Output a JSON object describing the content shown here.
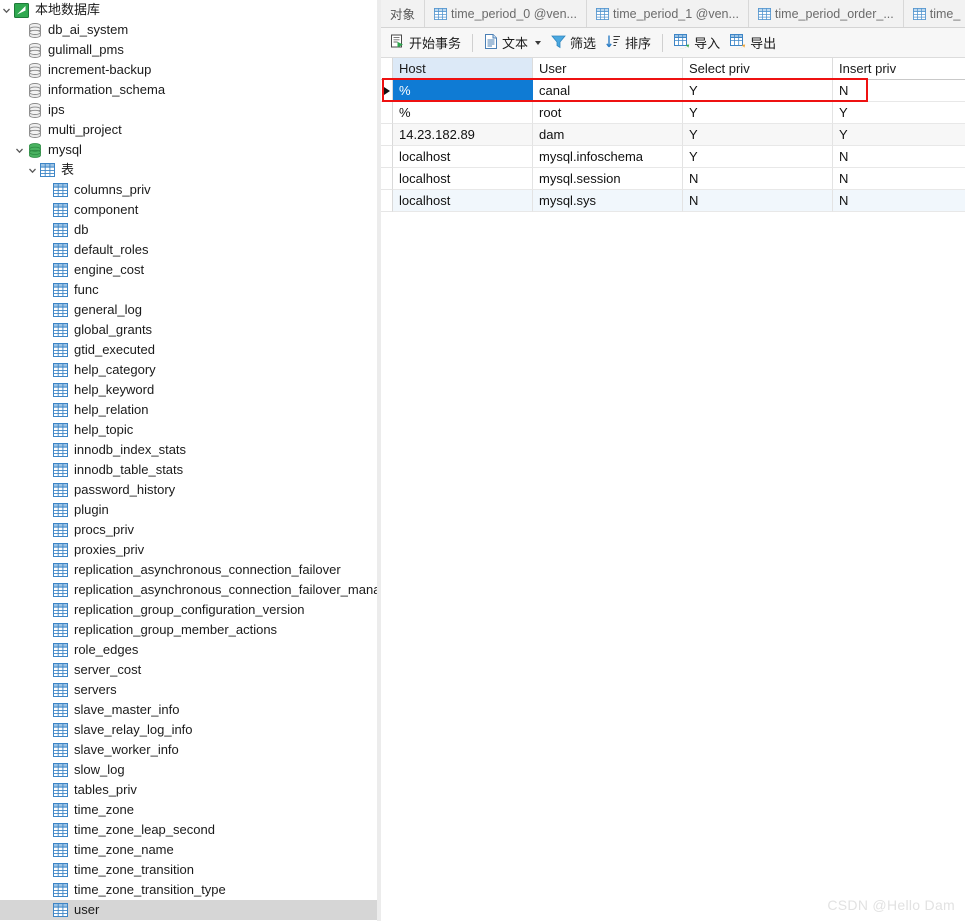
{
  "sidebar": {
    "root": {
      "label": "本地数据库",
      "icon": "navicat-connection-icon",
      "expanded": true
    },
    "databases": [
      {
        "label": "db_ai_system",
        "icon": "database-icon",
        "open": false
      },
      {
        "label": "gulimall_pms",
        "icon": "database-icon",
        "open": false
      },
      {
        "label": "increment-backup",
        "icon": "database-icon",
        "open": false
      },
      {
        "label": "information_schema",
        "icon": "database-icon",
        "open": false
      },
      {
        "label": "ips",
        "icon": "database-icon",
        "open": false
      },
      {
        "label": "multi_project",
        "icon": "database-icon",
        "open": false
      }
    ],
    "open_database": {
      "label": "mysql",
      "icon": "database-open-icon",
      "expanded": true
    },
    "tables_folder": {
      "label": "表",
      "icon": "table-folder-icon",
      "expanded": true
    },
    "tables": [
      {
        "label": "columns_priv",
        "selected": false
      },
      {
        "label": "component",
        "selected": false
      },
      {
        "label": "db",
        "selected": false
      },
      {
        "label": "default_roles",
        "selected": false
      },
      {
        "label": "engine_cost",
        "selected": false
      },
      {
        "label": "func",
        "selected": false
      },
      {
        "label": "general_log",
        "selected": false
      },
      {
        "label": "global_grants",
        "selected": false
      },
      {
        "label": "gtid_executed",
        "selected": false
      },
      {
        "label": "help_category",
        "selected": false
      },
      {
        "label": "help_keyword",
        "selected": false
      },
      {
        "label": "help_relation",
        "selected": false
      },
      {
        "label": "help_topic",
        "selected": false
      },
      {
        "label": "innodb_index_stats",
        "selected": false
      },
      {
        "label": "innodb_table_stats",
        "selected": false
      },
      {
        "label": "password_history",
        "selected": false
      },
      {
        "label": "plugin",
        "selected": false
      },
      {
        "label": "procs_priv",
        "selected": false
      },
      {
        "label": "proxies_priv",
        "selected": false
      },
      {
        "label": "replication_asynchronous_connection_failover",
        "selected": false
      },
      {
        "label": "replication_asynchronous_connection_failover_manag",
        "selected": false
      },
      {
        "label": "replication_group_configuration_version",
        "selected": false
      },
      {
        "label": "replication_group_member_actions",
        "selected": false
      },
      {
        "label": "role_edges",
        "selected": false
      },
      {
        "label": "server_cost",
        "selected": false
      },
      {
        "label": "servers",
        "selected": false
      },
      {
        "label": "slave_master_info",
        "selected": false
      },
      {
        "label": "slave_relay_log_info",
        "selected": false
      },
      {
        "label": "slave_worker_info",
        "selected": false
      },
      {
        "label": "slow_log",
        "selected": false
      },
      {
        "label": "tables_priv",
        "selected": false
      },
      {
        "label": "time_zone",
        "selected": false
      },
      {
        "label": "time_zone_leap_second",
        "selected": false
      },
      {
        "label": "time_zone_name",
        "selected": false
      },
      {
        "label": "time_zone_transition",
        "selected": false
      },
      {
        "label": "time_zone_transition_type",
        "selected": false
      },
      {
        "label": "user",
        "selected": true
      }
    ]
  },
  "tabs": [
    {
      "label": "对象",
      "icon": null,
      "active": false
    },
    {
      "label": "time_period_0 @ven...",
      "icon": "table-icon",
      "active": false
    },
    {
      "label": "time_period_1 @ven...",
      "icon": "table-icon",
      "active": false
    },
    {
      "label": "time_period_order_...",
      "icon": "table-icon",
      "active": false
    },
    {
      "label": "time_",
      "icon": "table-icon",
      "active": false
    }
  ],
  "toolbar": {
    "begin_transaction": {
      "label": "开始事务",
      "icon": "transaction-icon"
    },
    "text": {
      "label": "文本",
      "icon": "text-document-icon",
      "has_dropdown": true
    },
    "filter": {
      "label": "筛选",
      "icon": "funnel-icon"
    },
    "sort": {
      "label": "排序",
      "icon": "sort-icon"
    },
    "import": {
      "label": "导入",
      "icon": "import-icon"
    },
    "export": {
      "label": "导出",
      "icon": "export-icon"
    }
  },
  "grid": {
    "columns": [
      {
        "key": "host",
        "label": "Host",
        "active": true
      },
      {
        "key": "user",
        "label": "User",
        "active": false
      },
      {
        "key": "select_priv",
        "label": "Select priv",
        "active": false
      },
      {
        "key": "insert_priv",
        "label": "Insert priv",
        "active": false
      }
    ],
    "rows": [
      {
        "host": "%",
        "user": "canal",
        "select_priv": "Y",
        "insert_priv": "N",
        "current": true,
        "cell_selected": "host"
      },
      {
        "host": "%",
        "user": "root",
        "select_priv": "Y",
        "insert_priv": "Y",
        "current": false
      },
      {
        "host": "14.23.182.89",
        "user": "dam",
        "select_priv": "Y",
        "insert_priv": "Y",
        "current": false
      },
      {
        "host": "localhost",
        "user": "mysql.infoschema",
        "select_priv": "Y",
        "insert_priv": "N",
        "current": false
      },
      {
        "host": "localhost",
        "user": "mysql.session",
        "select_priv": "N",
        "insert_priv": "N",
        "current": false
      },
      {
        "host": "localhost",
        "user": "mysql.sys",
        "select_priv": "N",
        "insert_priv": "N",
        "current": false
      }
    ]
  },
  "annotation": {
    "type": "red-rectangle",
    "color": "#ee1111",
    "targets_row": 1
  },
  "watermark": {
    "text": "CSDN @Hello Dam"
  },
  "colors": {
    "selection_blue": "#0f7bd4",
    "active_column_header": "#dce9f7",
    "tree_selection_gray": "#d6d6d6",
    "annotation_red": "#ee1111",
    "table_icon_blue": "#3d85c6",
    "db_open_green": "#3fa34d"
  }
}
